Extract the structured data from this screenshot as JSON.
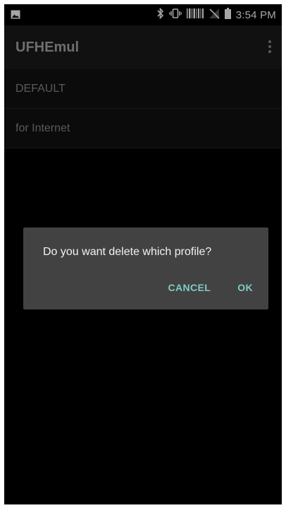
{
  "status_bar": {
    "time": "3:54 PM",
    "icons": [
      "image-icon",
      "bluetooth-icon",
      "vibrate-icon",
      "barcode-icon",
      "no-sim-icon",
      "battery-icon"
    ]
  },
  "app_bar": {
    "title": "UFHEmul",
    "menu_icon": "more-vert-icon"
  },
  "profiles": [
    {
      "label": "DEFAULT"
    },
    {
      "label": "for Internet"
    }
  ],
  "dialog": {
    "message": "Do you want delete which profile?",
    "cancel_label": "CANCEL",
    "ok_label": "OK",
    "accent_color": "#80cbc4"
  }
}
